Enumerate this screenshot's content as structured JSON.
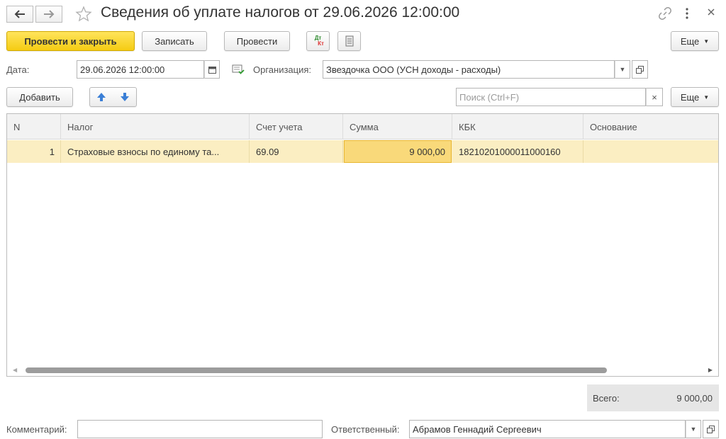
{
  "header": {
    "title": "Сведения об уплате налогов от 29.06.2026 12:00:00"
  },
  "toolbar": {
    "post_close_label": "Провести и закрыть",
    "save_label": "Записать",
    "post_label": "Провести",
    "dt_kt_label_top": "Дт",
    "dt_kt_label_bottom": "Кт",
    "more_label": "Еще"
  },
  "form": {
    "date_label": "Дата:",
    "date_value": "29.06.2026 12:00:00",
    "org_label": "Организация:",
    "org_value": "Звездочка ООО (УСН доходы - расходы)"
  },
  "table_toolbar": {
    "add_label": "Добавить",
    "search_placeholder": "Поиск (Ctrl+F)",
    "clear_symbol": "×",
    "more_label": "Еще"
  },
  "table": {
    "columns": [
      "N",
      "Налог",
      "Счет учета",
      "Сумма",
      "КБК",
      "Основание"
    ],
    "rows": [
      {
        "n": "1",
        "tax": "Страховые взносы по единому та...",
        "account": "69.09",
        "amount": "9 000,00",
        "kbk": "18210201000011000160",
        "basis": ""
      }
    ]
  },
  "footer": {
    "total_label": "Всего:",
    "total_value": "9 000,00",
    "comment_label": "Комментарий:",
    "comment_value": "",
    "responsible_label": "Ответственный:",
    "responsible_value": "Абрамов Геннадий Сергеевич"
  },
  "colors": {
    "primary_button": "#f5cc13",
    "selected_row": "#fbeec2",
    "active_cell": "#f9d97a"
  }
}
